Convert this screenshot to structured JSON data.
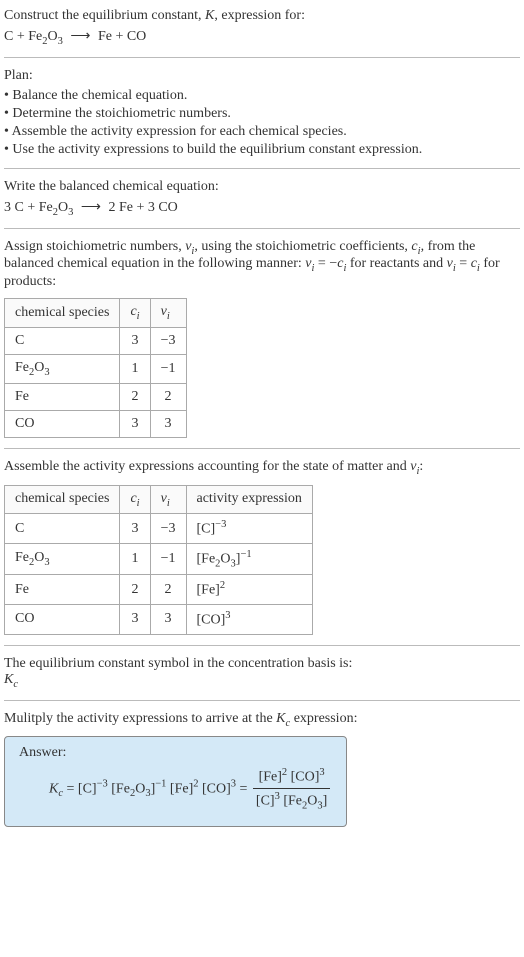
{
  "intro": {
    "line1": "Construct the equilibrium constant, ",
    "line1_K": "K",
    "line1_end": ", expression for:",
    "reaction_lhs": "C + Fe",
    "reaction_sub1": "2",
    "reaction_O": "O",
    "reaction_sub2": "3",
    "reaction_rhs": "  Fe + CO"
  },
  "plan": {
    "header": "Plan:",
    "b1": "• Balance the chemical equation.",
    "b2": "• Determine the stoichiometric numbers.",
    "b3": "• Assemble the activity expression for each chemical species.",
    "b4": "• Use the activity expressions to build the equilibrium constant expression."
  },
  "balanced": {
    "header": "Write the balanced chemical equation:",
    "lhs1": "3 C + Fe",
    "sub1": "2",
    "O": "O",
    "sub2": "3",
    "rhs": "  2 Fe + 3 CO"
  },
  "assign": {
    "line1a": "Assign stoichiometric numbers, ",
    "nu_i": "ν",
    "sub_i": "i",
    "line1b": ", using the stoichiometric coefficients, ",
    "c_i": "c",
    "line1c": ", from the balanced chemical equation in the following manner: ",
    "eq1a": "ν",
    "eq1b": " = −",
    "eq1c": "c",
    "line1d": " for reactants and ",
    "eq2a": "ν",
    "eq2b": " = ",
    "eq2c": "c",
    "line1e": " for products:"
  },
  "table1": {
    "h1": "chemical species",
    "h2_c": "c",
    "h2_i": "i",
    "h3_nu": "ν",
    "h3_i": "i",
    "rows": [
      {
        "species": "C",
        "c": "3",
        "nu": "−3"
      },
      {
        "species_pre": "Fe",
        "s1": "2",
        "species_mid": "O",
        "s2": "3",
        "c": "1",
        "nu": "−1"
      },
      {
        "species": "Fe",
        "c": "2",
        "nu": "2"
      },
      {
        "species": "CO",
        "c": "3",
        "nu": "3"
      }
    ]
  },
  "assemble": {
    "line1a": "Assemble the activity expressions accounting for the state of matter and ",
    "nu": "ν",
    "sub_i": "i",
    "line1b": ":"
  },
  "table2": {
    "h1": "chemical species",
    "h2_c": "c",
    "h2_i": "i",
    "h3_nu": "ν",
    "h3_i": "i",
    "h4": "activity expression",
    "rows": [
      {
        "species": "C",
        "c": "3",
        "nu": "−3",
        "act_pre": "[C]",
        "act_sup": "−3"
      },
      {
        "species_pre": "Fe",
        "s1": "2",
        "species_mid": "O",
        "s2": "3",
        "c": "1",
        "nu": "−1",
        "act_pre": "[Fe",
        "act_s1": "2",
        "act_mid": "O",
        "act_s2": "3",
        "act_post": "]",
        "act_sup": "−1"
      },
      {
        "species": "Fe",
        "c": "2",
        "nu": "2",
        "act_pre": "[Fe]",
        "act_sup": "2"
      },
      {
        "species": "CO",
        "c": "3",
        "nu": "3",
        "act_pre": "[CO]",
        "act_sup": "3"
      }
    ]
  },
  "symbol": {
    "line": "The equilibrium constant symbol in the concentration basis is:",
    "K": "K",
    "sub_c": "c"
  },
  "multiply": {
    "line1a": "Mulitply the activity expressions to arrive at the ",
    "K": "K",
    "sub_c": "c",
    "line1b": " expression:"
  },
  "answer": {
    "label": "Answer:",
    "K": "K",
    "sub_c": "c",
    "eq": " = ",
    "t1": "[C]",
    "t1_sup": "−3",
    "t2_pre": " [Fe",
    "t2_s1": "2",
    "t2_mid": "O",
    "t2_s2": "3",
    "t2_post": "]",
    "t2_sup": "−1",
    "t3": " [Fe]",
    "t3_sup": "2",
    "t4": " [CO]",
    "t4_sup": "3",
    "eq2": " = ",
    "num1": "[Fe]",
    "num1_sup": "2",
    "num2": " [CO]",
    "num2_sup": "3",
    "den1": "[C]",
    "den1_sup": "3",
    "den2_pre": " [Fe",
    "den2_s1": "2",
    "den2_mid": "O",
    "den2_s2": "3",
    "den2_post": "]"
  }
}
